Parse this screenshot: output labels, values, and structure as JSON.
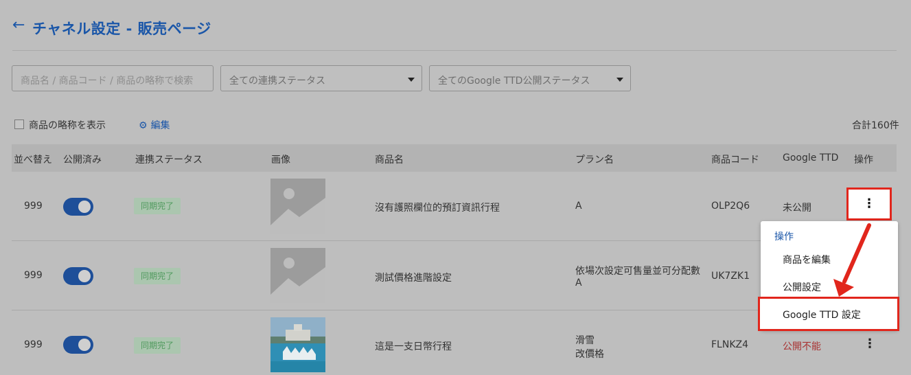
{
  "header": {
    "back_icon": "arrow-left-icon",
    "title": "チャネル設定  - 販売ページ"
  },
  "filters": {
    "search_placeholder": "商品名 / 商品コード / 商品の略称で検索",
    "sync_status_select": "全ての連携ステータス",
    "ttd_status_select": "全てのGoogle TTD公開ステータス"
  },
  "options": {
    "show_short_name_label": "商品の略称を表示",
    "edit_label": "編集",
    "total_label": "合計160件"
  },
  "table": {
    "headers": [
      "並べ替え",
      "公開済み",
      "連携ステータス",
      "画像",
      "商品名",
      "プラン名",
      "商品コード",
      "Google TTD",
      "操作"
    ],
    "rows": [
      {
        "sort": "999",
        "published": true,
        "sync_status": "同期完了",
        "image": "placeholder",
        "product_name": "沒有護照欄位的預訂資訊行程",
        "plan_name": [
          "A"
        ],
        "product_code": "OLP2Q6",
        "google_ttd": "未公開"
      },
      {
        "sort": "999",
        "published": true,
        "sync_status": "同期完了",
        "image": "placeholder",
        "product_name": "測試價格進階設定",
        "plan_name": [
          "依場次設定可售量並可分配數",
          "A"
        ],
        "product_code": "UK7ZK1",
        "google_ttd": ""
      },
      {
        "sort": "999",
        "published": true,
        "sync_status": "同期完了",
        "image": "photo",
        "product_name": "這是一支日幣行程",
        "plan_name": [
          "滑雪",
          "改價格"
        ],
        "product_code": "FLNKZ4",
        "google_ttd": "公開不能"
      }
    ]
  },
  "menu": {
    "heading": "操作",
    "items": [
      "商品を編集",
      "公開設定",
      "Google TTD 設定"
    ],
    "highlighted_item": "Google TTD 設定"
  },
  "colors": {
    "accent": "#1a56a8",
    "highlight_red": "#e1261c",
    "badge_green": "#4f9a5d",
    "error_red": "#a83232"
  }
}
